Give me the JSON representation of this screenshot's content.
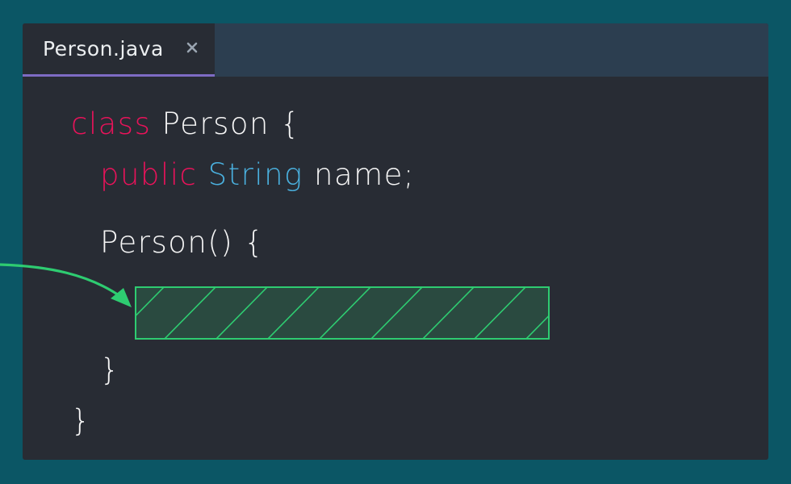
{
  "tab": {
    "filename": "Person.java",
    "close_symbol": "×"
  },
  "code": {
    "line1": {
      "keyword": "class",
      "rest": " Person {"
    },
    "line2": {
      "keyword": "public",
      "type": "String",
      "rest": " name;"
    },
    "line3": {
      "text": "Person() {"
    },
    "line5": {
      "text": "}"
    },
    "line6": {
      "text": "}"
    }
  },
  "colors": {
    "background": "#0b5665",
    "editor": "#282c34",
    "tabbar": "#2c3e50",
    "tab_underline": "#7e6bc4",
    "keyword": "#e8135a",
    "type": "#4ab0de",
    "highlight": "#2ecc71"
  }
}
